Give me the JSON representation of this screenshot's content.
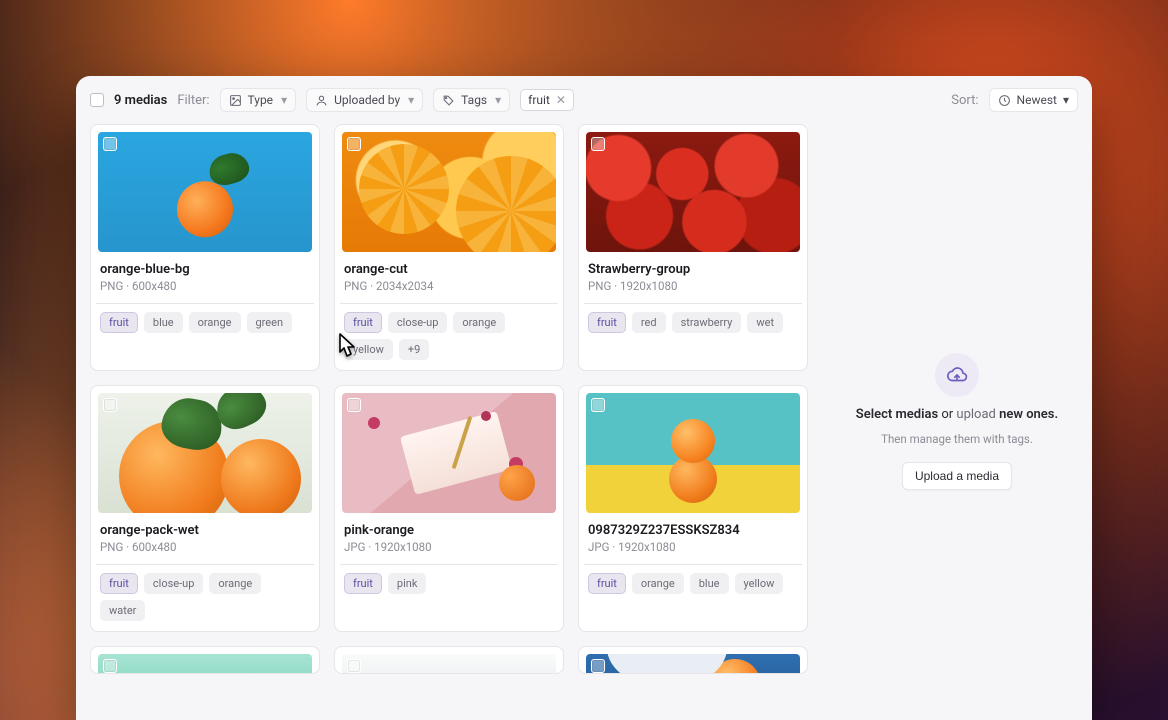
{
  "toolbar": {
    "count_label": "9 medias",
    "filter_label": "Filter:",
    "type_label": "Type",
    "uploaded_by_label": "Uploaded by",
    "tags_label": "Tags",
    "applied_filter": "fruit",
    "sort_label": "Sort:",
    "sort_value": "Newest"
  },
  "sidebar": {
    "headline_pre": "Select medias",
    "headline_or": " or ",
    "headline_link": "upload",
    "headline_post": " new ones.",
    "sub": "Then manage them with tags.",
    "button": "Upload a media"
  },
  "cards": [
    {
      "title": "orange-blue-bg",
      "meta": "PNG · 600x480",
      "tags": [
        "fruit",
        "blue",
        "orange",
        "green"
      ]
    },
    {
      "title": "orange-cut",
      "meta": "PNG · 2034x2034",
      "tags": [
        "fruit",
        "close-up",
        "orange",
        "yellow",
        "+9"
      ]
    },
    {
      "title": "Strawberry-group",
      "meta": "PNG · 1920x1080",
      "tags": [
        "fruit",
        "red",
        "strawberry",
        "wet"
      ]
    },
    {
      "title": "orange-pack-wet",
      "meta": "PNG · 600x480",
      "tags": [
        "fruit",
        "close-up",
        "orange",
        "water"
      ]
    },
    {
      "title": "pink-orange",
      "meta": "JPG · 1920x1080",
      "tags": [
        "fruit",
        "pink"
      ]
    },
    {
      "title": "0987329Z237ESSKSZ834",
      "meta": "JPG · 1920x1080",
      "tags": [
        "fruit",
        "orange",
        "blue",
        "yellow"
      ]
    }
  ]
}
